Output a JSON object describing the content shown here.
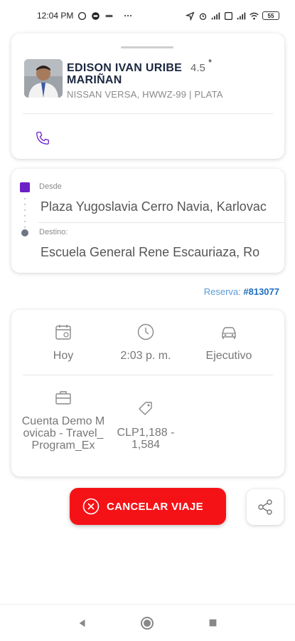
{
  "status_bar": {
    "time": "12:04 PM",
    "battery": "55"
  },
  "driver": {
    "name": "EDISON IVAN URIBE MARIÑAN",
    "rating": "4.5",
    "rating_star": "*",
    "vehicle": "NISSAN VERSA, HWWZ-99 | PLATA"
  },
  "route": {
    "origin_label": "Desde",
    "origin_address": "Plaza Yugoslavia Cerro Navia, Karlovac",
    "destination_label": "Destino:",
    "destination_address": "Escuela General Rene Escauriaza, Ro"
  },
  "reservation": {
    "label": "Reserva:",
    "number": "#813077"
  },
  "trip_info": {
    "date": "Hoy",
    "time": "2:03 p. m.",
    "service": "Ejecutivo",
    "account": "Cuenta Demo Movicab - Travel_Program_Ex",
    "price": "CLP1,188 - 1,584"
  },
  "actions": {
    "cancel_label": "CANCELAR VIAJE"
  },
  "colors": {
    "accent": "#6a1fc7",
    "cancel": "#f51216",
    "link": "#1e6fc2"
  },
  "icons": [
    "phone-icon",
    "calendar-icon",
    "clock-icon",
    "car-icon",
    "briefcase-icon",
    "tag-icon",
    "close-circle-icon",
    "share-icon"
  ]
}
